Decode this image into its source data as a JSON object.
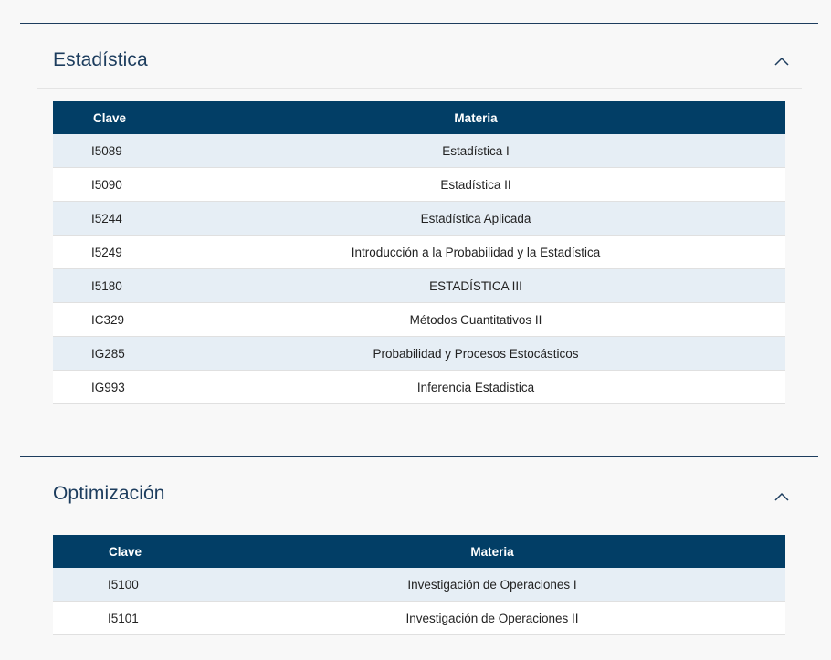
{
  "sections": [
    {
      "title": "Estadística",
      "headers": {
        "clave": "Clave",
        "materia": "Materia"
      },
      "rows": [
        {
          "clave": "I5089",
          "materia": "Estadística I"
        },
        {
          "clave": "I5090",
          "materia": "Estadística II"
        },
        {
          "clave": "I5244",
          "materia": "Estadística Aplicada"
        },
        {
          "clave": "I5249",
          "materia": "Introducción a la Probabilidad y la Estadística"
        },
        {
          "clave": "I5180",
          "materia": "ESTADÍSTICA III"
        },
        {
          "clave": "IC329",
          "materia": "Métodos Cuantitativos II"
        },
        {
          "clave": "IG285",
          "materia": "Probabilidad y Procesos Estocásticos"
        },
        {
          "clave": "IG993",
          "materia": "Inferencia Estadistica"
        }
      ]
    },
    {
      "title": "Optimización",
      "headers": {
        "clave": "Clave",
        "materia": "Materia"
      },
      "rows": [
        {
          "clave": "I5100",
          "materia": "Investigación de Operaciones I"
        },
        {
          "clave": "I5101",
          "materia": "Investigación de Operaciones II"
        }
      ]
    }
  ],
  "icons": {
    "collapse": "chevron-up-icon"
  },
  "colors": {
    "header_bg": "#023e66",
    "title": "#1d3d5e",
    "row_alt": "#e6eef5"
  }
}
